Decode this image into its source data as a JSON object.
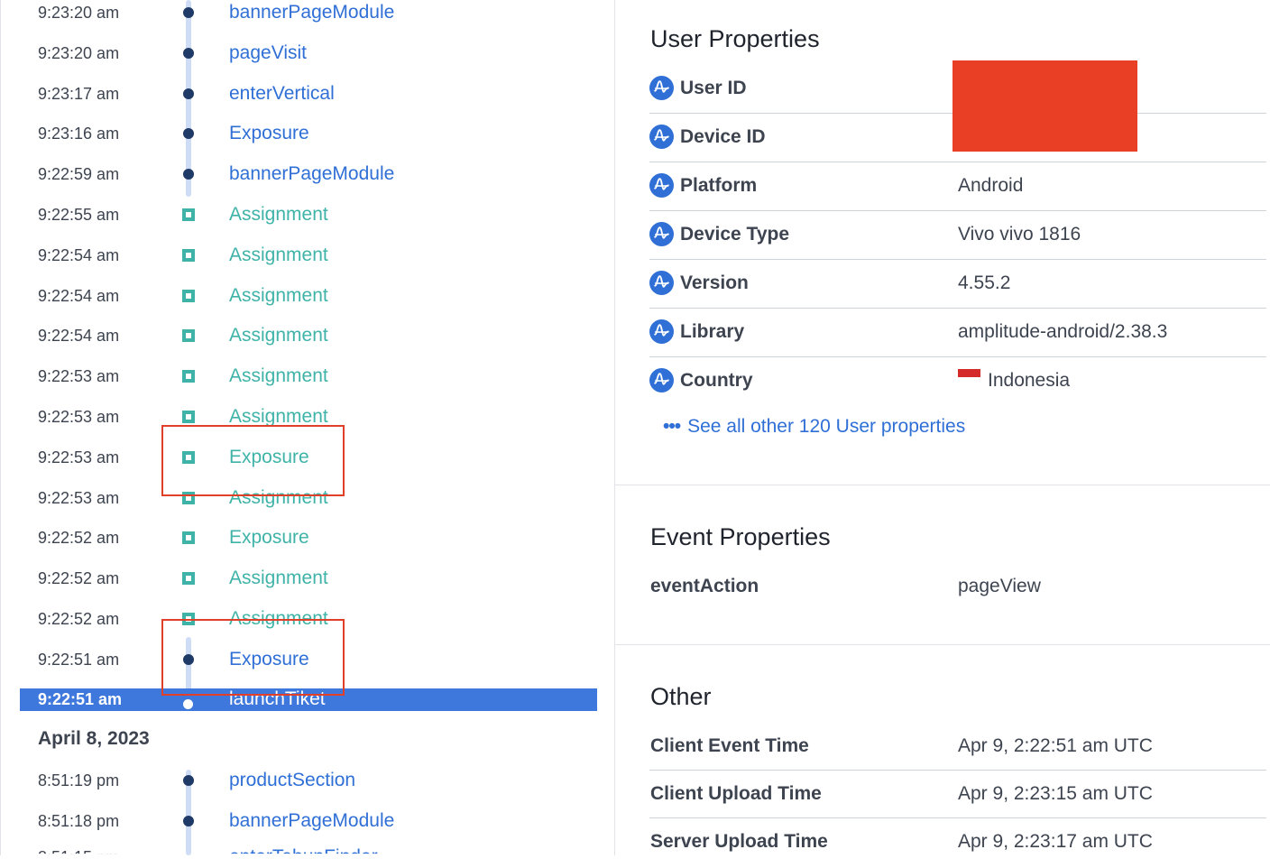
{
  "timeline": {
    "events_a": [
      {
        "time": "9:23:20 am",
        "name": "bannerPageModule",
        "kind": "dot",
        "color": "blue"
      },
      {
        "time": "9:23:20 am",
        "name": "pageVisit",
        "kind": "dot",
        "color": "blue"
      },
      {
        "time": "9:23:17 am",
        "name": "enterVertical",
        "kind": "dot",
        "color": "blue"
      },
      {
        "time": "9:23:16 am",
        "name": "Exposure",
        "kind": "dot",
        "color": "blue"
      },
      {
        "time": "9:22:59 am",
        "name": "bannerPageModule",
        "kind": "dot",
        "color": "blue"
      },
      {
        "time": "9:22:55 am",
        "name": "Assignment",
        "kind": "square",
        "color": "teal"
      },
      {
        "time": "9:22:54 am",
        "name": "Assignment",
        "kind": "square",
        "color": "teal"
      },
      {
        "time": "9:22:54 am",
        "name": "Assignment",
        "kind": "square",
        "color": "teal"
      },
      {
        "time": "9:22:54 am",
        "name": "Assignment",
        "kind": "square",
        "color": "teal"
      },
      {
        "time": "9:22:53 am",
        "name": "Assignment",
        "kind": "square",
        "color": "teal"
      },
      {
        "time": "9:22:53 am",
        "name": "Assignment",
        "kind": "square",
        "color": "teal"
      },
      {
        "time": "9:22:53 am",
        "name": "Exposure",
        "kind": "square",
        "color": "teal"
      },
      {
        "time": "9:22:53 am",
        "name": "Assignment",
        "kind": "square",
        "color": "teal"
      },
      {
        "time": "9:22:52 am",
        "name": "Exposure",
        "kind": "square",
        "color": "teal"
      },
      {
        "time": "9:22:52 am",
        "name": "Assignment",
        "kind": "square",
        "color": "teal"
      },
      {
        "time": "9:22:52 am",
        "name": "Assignment",
        "kind": "square",
        "color": "teal"
      },
      {
        "time": "9:22:51 am",
        "name": "Exposure",
        "kind": "dot",
        "color": "blue"
      },
      {
        "time": "9:22:51 am",
        "name": "launchTiket",
        "kind": "dot",
        "color": "blue",
        "selected": true
      }
    ],
    "date_header": "April 8, 2023",
    "events_b": [
      {
        "time": "8:51:19 pm",
        "name": "productSection",
        "kind": "dot",
        "color": "blue"
      },
      {
        "time": "8:51:18 pm",
        "name": "bannerPageModule",
        "kind": "dot",
        "color": "blue"
      }
    ]
  },
  "user_properties": {
    "title": "User Properties",
    "rows": [
      {
        "label": "User ID",
        "value": ""
      },
      {
        "label": "Device ID",
        "value": ""
      },
      {
        "label": "Platform",
        "value": "Android"
      },
      {
        "label": "Device Type",
        "value": "Vivo vivo 1816"
      },
      {
        "label": "Version",
        "value": "4.55.2"
      },
      {
        "label": "Library",
        "value": "amplitude-android/2.38.3"
      },
      {
        "label": "Country",
        "value": "Indonesia"
      }
    ],
    "see_all": "See all other 120 User properties"
  },
  "event_properties": {
    "title": "Event Properties",
    "rows": [
      {
        "label": "eventAction",
        "value": "pageView"
      }
    ]
  },
  "other": {
    "title": "Other",
    "rows": [
      {
        "label": "Client Event Time",
        "value": "Apr 9, 2:22:51 am UTC"
      },
      {
        "label": "Client Upload Time",
        "value": "Apr 9, 2:23:15 am UTC"
      },
      {
        "label": "Server Upload Time",
        "value": "Apr 9, 2:23:17 am UTC"
      }
    ]
  },
  "colors": {
    "accent_blue": "#2f6fd6",
    "teal": "#3fb3a8",
    "selected_row": "#3f78dc",
    "highlight_red": "#e0402a",
    "redaction": "#e94025"
  }
}
